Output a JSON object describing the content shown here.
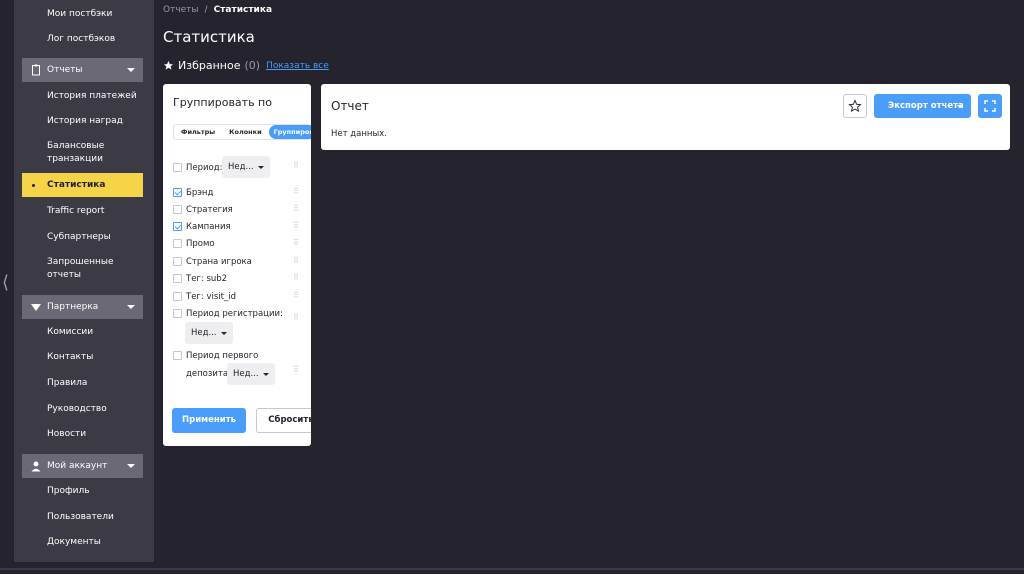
{
  "sidebar": {
    "items_top": [
      "Мои постбэки",
      "Лог постбэков"
    ],
    "reports_section": "Отчеты",
    "reports_items": [
      "История платежей",
      "История наград",
      "Балансовые транзакции",
      "Статистика",
      "Traffic report",
      "Субпартнеры",
      "Запрошенные отчеты"
    ],
    "partner_section": "Партнерка",
    "partner_items": [
      "Комиссии",
      "Контакты",
      "Правила",
      "Руководство",
      "Новости"
    ],
    "account_section": "Мой аккаунт",
    "account_items": [
      "Профиль",
      "Пользователи",
      "Документы"
    ]
  },
  "breadcrumb": {
    "parent": "Отчеты",
    "separator": "/",
    "current": "Статистика"
  },
  "page_title": "Статистика",
  "favorites": {
    "label": "Избранное",
    "count": "(0)",
    "show_all": "Показать все"
  },
  "group_panel": {
    "title": "Группировать по",
    "tabs": [
      "Фильтры",
      "Колонки",
      "Группироват"
    ],
    "options": [
      {
        "label": "Период:",
        "checked": false,
        "select": "Нед..."
      },
      {
        "label": "Брэнд",
        "checked": true
      },
      {
        "label": "Стратегия",
        "checked": false
      },
      {
        "label": "Кампания",
        "checked": true
      },
      {
        "label": "Промо",
        "checked": false
      },
      {
        "label": "Страна игрока",
        "checked": false
      },
      {
        "label": "Тег: sub2",
        "checked": false
      },
      {
        "label": "Тег: visit_id",
        "checked": false
      },
      {
        "label": "Период регистрации:",
        "checked": false,
        "select": "Нед..."
      },
      {
        "label": "Период первого",
        "label2": "депозита:",
        "checked": false,
        "select": "Нед..."
      }
    ],
    "apply": "Применить",
    "reset": "Сбросить"
  },
  "report": {
    "title": "Отчет",
    "empty": "Нет данных.",
    "export": "Экспорт отчета"
  },
  "colors": {
    "accent": "#4a9dfb",
    "active": "#f5d44a",
    "bg": "#25232d",
    "sidebar": "#3c3a45"
  }
}
